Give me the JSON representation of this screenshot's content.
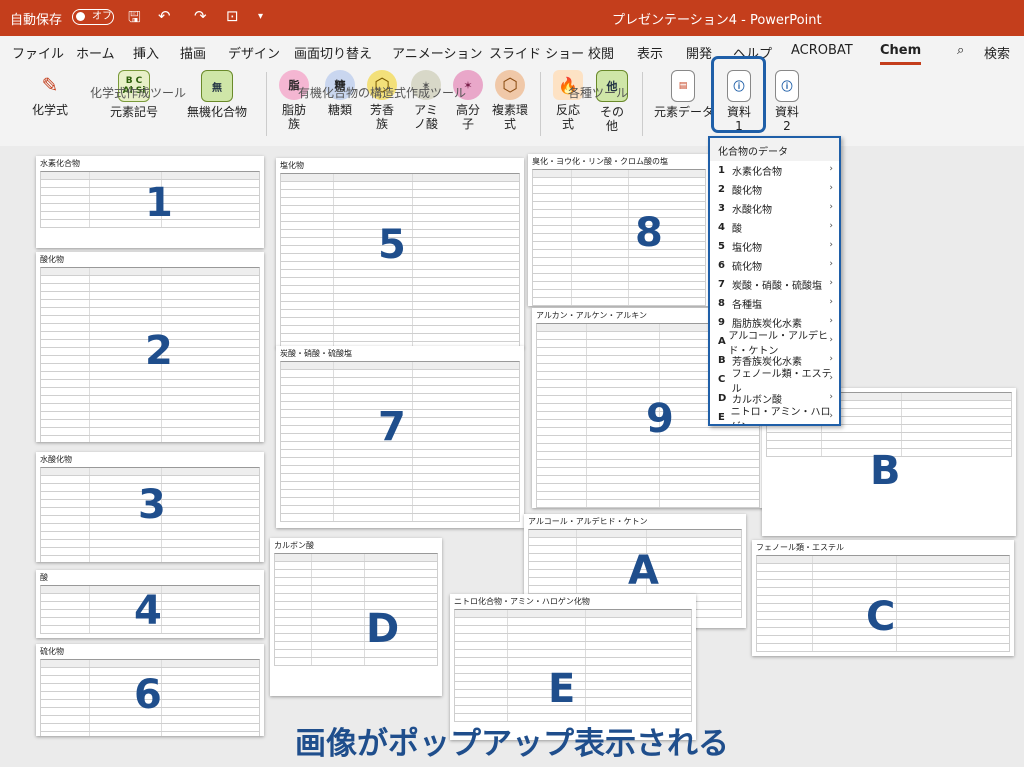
{
  "titlebar": {
    "autosave": "自動保存",
    "toggle": "オフ",
    "document": "プレゼンテーション4 - PowerPoint"
  },
  "tabs": [
    "ファイル",
    "ホーム",
    "挿入",
    "描画",
    "デザイン",
    "画面切り替え",
    "アニメーション",
    "スライド ショー",
    "校閲",
    "表示",
    "開発",
    "ヘルプ",
    "ACROBAT",
    "Chem",
    "検索"
  ],
  "ribbon": {
    "buttons": [
      {
        "label": "化学式",
        "icon": "pen-icon"
      },
      {
        "label": "元素記号",
        "icon": "element-icon"
      },
      {
        "label": "無機化合物",
        "icon": "inorganic-icon"
      },
      {
        "label": "脂肪族",
        "icon": "aliphatic-icon",
        "glyph": "脂"
      },
      {
        "label": "糖類",
        "icon": "sugar-icon",
        "glyph": "糖"
      },
      {
        "label": "芳香族",
        "icon": "aromatic-icon",
        "glyph": "⬡"
      },
      {
        "label": "アミノ酸",
        "icon": "amino-icon",
        "glyph": "✶"
      },
      {
        "label": "高分子",
        "icon": "polymer-icon",
        "glyph": "✶"
      },
      {
        "label": "複素環式",
        "icon": "heterocycle-icon",
        "glyph": "⬡"
      },
      {
        "label": "反応式",
        "icon": "reaction-icon",
        "glyph": "🔥"
      },
      {
        "label": "その他",
        "icon": "other-icon",
        "glyph": "他"
      },
      {
        "label": "元素データ",
        "icon": "data-icon"
      },
      {
        "label": "資料1",
        "icon": "document-info-icon"
      },
      {
        "label": "資料2",
        "icon": "document-info-icon"
      }
    ],
    "groups": [
      "化学式作成ツール",
      "有機化合物の構造式作成ツール",
      "各種ツール"
    ]
  },
  "sheets": [
    {
      "id": "1",
      "title": "水素化合物",
      "rows": 7
    },
    {
      "id": "2",
      "title": "酸化物",
      "rows": 22
    },
    {
      "id": "3",
      "title": "水酸化物",
      "rows": 12
    },
    {
      "id": "4",
      "title": "酸",
      "rows": 6
    },
    {
      "id": "6",
      "title": "硫化物",
      "rows": 10
    },
    {
      "id": "5",
      "title": "塩化物",
      "rows": 24
    },
    {
      "id": "7",
      "title": "炭酸・硝酸・硫酸塩",
      "rows": 20
    },
    {
      "id": "8",
      "title": "臭化・ヨウ化・リン酸・クロム酸の塩",
      "rows": 18
    },
    {
      "id": "9",
      "title": "アルカン・アルケン・アルキン",
      "rows": 24
    },
    {
      "id": "B",
      "title": "",
      "rows": 8
    },
    {
      "id": "A",
      "title": "アルコール・アルデヒド・ケトン",
      "rows": 11
    },
    {
      "id": "D",
      "title": "カルボン酸",
      "rows": 14
    },
    {
      "id": "E",
      "title": "ニトロ化合物・アミン・ハロゲン化物",
      "rows": 14
    },
    {
      "id": "C",
      "title": "フェノール類・エステル",
      "rows": 12
    }
  ],
  "dropdown": {
    "header": "化合物のデータ",
    "items": [
      {
        "key": "1",
        "label": "水素化合物"
      },
      {
        "key": "2",
        "label": "酸化物"
      },
      {
        "key": "3",
        "label": "水酸化物"
      },
      {
        "key": "4",
        "label": "酸"
      },
      {
        "key": "5",
        "label": "塩化物"
      },
      {
        "key": "6",
        "label": "硫化物"
      },
      {
        "key": "7",
        "label": "炭酸・硝酸・硫酸塩"
      },
      {
        "key": "8",
        "label": "各種塩"
      },
      {
        "key": "9",
        "label": "脂肪族炭化水素"
      },
      {
        "key": "A",
        "label": "アルコール・アルデヒド・ケトン"
      },
      {
        "key": "B",
        "label": "芳香族炭化水素"
      },
      {
        "key": "C",
        "label": "フェノール類・エステル"
      },
      {
        "key": "D",
        "label": "カルボン酸"
      },
      {
        "key": "E",
        "label": "ニトロ・アミン・ハロゲン"
      }
    ]
  },
  "caption": "画像がポップアップ表示される",
  "colors": {
    "titlebar": "#c43e1c",
    "accent": "#1f4e8c",
    "highlight": "#1f5fa8"
  }
}
